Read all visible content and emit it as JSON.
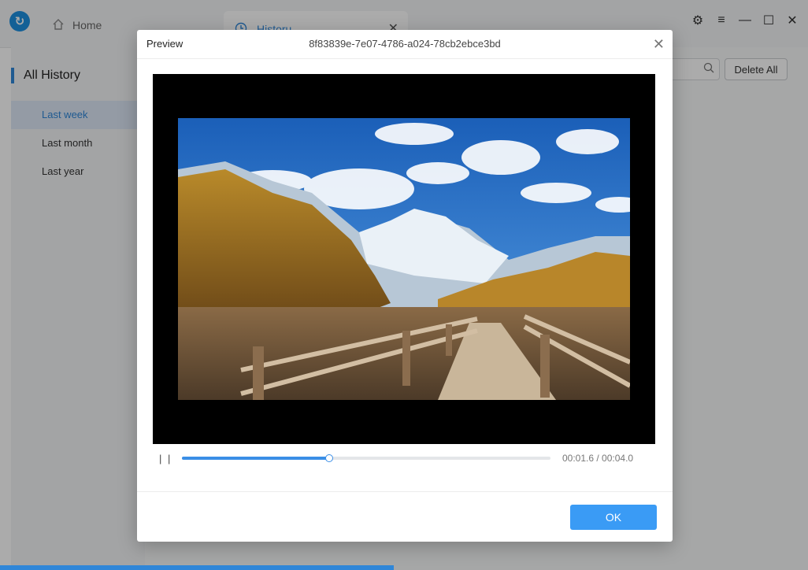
{
  "app": {
    "tabs": [
      {
        "label": "Home",
        "icon": "home-icon"
      },
      {
        "label": "Historu",
        "icon": "clock-icon"
      }
    ],
    "window_controls": [
      "gear-icon",
      "menu-icon",
      "minimize-icon",
      "maximize-icon",
      "close-icon"
    ]
  },
  "sidebar": {
    "title": "All History",
    "items": [
      {
        "label": "Last week",
        "active": true
      },
      {
        "label": "Last month",
        "active": false
      },
      {
        "label": "Last year",
        "active": false
      }
    ]
  },
  "main": {
    "delete_all_label": "Delete All",
    "rows": [
      {
        "actions": [
          "play-icon",
          "folder-icon",
          "close-icon"
        ]
      },
      {
        "actions": [
          "play-icon",
          "folder-icon",
          "close-icon"
        ]
      }
    ]
  },
  "dialog": {
    "title": "Preview",
    "file_id": "8f83839e-7e07-4786-a024-78cb2ebce3bd",
    "ok_label": "OK",
    "player": {
      "pause_glyph": "| |",
      "time_text": "00:01.6 / 00:04.0",
      "progress": 0.4
    }
  },
  "colors": {
    "accent": "#3a9bf5",
    "sidebar_active_bg": "#dde8f6",
    "accent_text": "#2f86d8"
  }
}
